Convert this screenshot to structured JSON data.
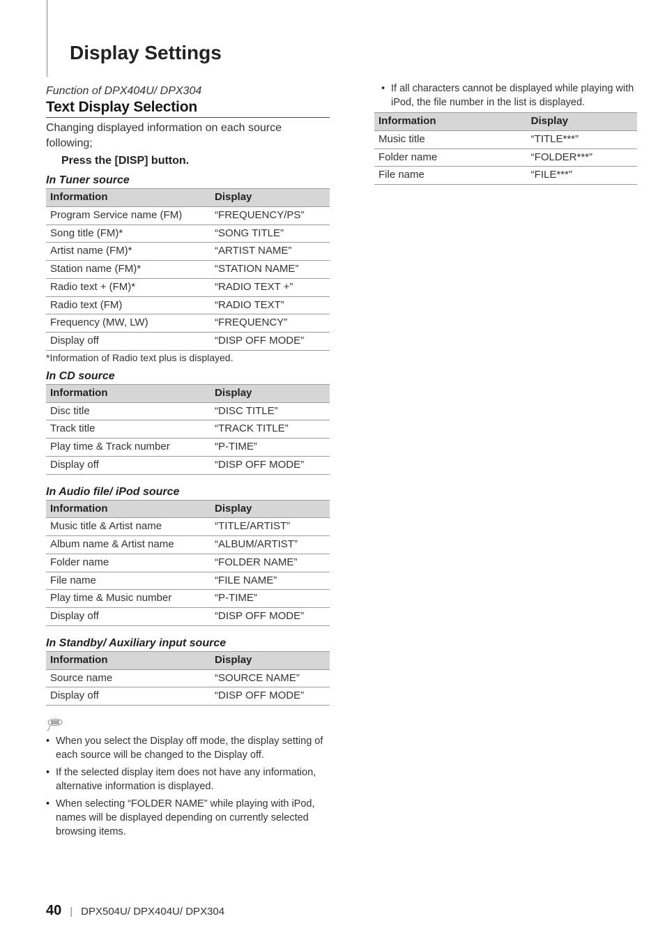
{
  "page": {
    "title": "Display Settings",
    "number": "40",
    "models": "DPX504U/ DPX404U/ DPX304"
  },
  "left": {
    "function_of": "Function of DPX404U/ DPX304",
    "section_heading": "Text Display Selection",
    "intro": "Changing displayed information on each source following;",
    "press": "Press the [DISP] button.",
    "tuner": {
      "heading": "In Tuner source",
      "cols": {
        "c1": "Information",
        "c2": "Display"
      },
      "rows": [
        {
          "c1": "Program Service name (FM)",
          "c2": "“FREQUENCY/PS”"
        },
        {
          "c1": "Song title (FM)*",
          "c2": "“SONG TITLE”"
        },
        {
          "c1": "Artist name (FM)*",
          "c2": "“ARTIST NAME”"
        },
        {
          "c1": "Station name (FM)*",
          "c2": "“STATION NAME”"
        },
        {
          "c1": "Radio text + (FM)*",
          "c2": "“RADIO TEXT +”"
        },
        {
          "c1": "Radio text (FM)",
          "c2": "“RADIO TEXT”"
        },
        {
          "c1": "Frequency (MW, LW)",
          "c2": "“FREQUENCY”"
        },
        {
          "c1": "Display off",
          "c2": "“DISP OFF MODE”"
        }
      ],
      "footnote": "*Information of Radio text plus is displayed."
    },
    "cd": {
      "heading": "In CD source",
      "cols": {
        "c1": "Information",
        "c2": "Display"
      },
      "rows": [
        {
          "c1": "Disc title",
          "c2": "“DISC TITLE”"
        },
        {
          "c1": "Track title",
          "c2": "“TRACK TITLE”"
        },
        {
          "c1": "Play time & Track number",
          "c2": "“P-TIME”"
        },
        {
          "c1": "Display off",
          "c2": "“DISP OFF MODE”"
        }
      ]
    },
    "audio": {
      "heading": "In Audio file/ iPod source",
      "cols": {
        "c1": "Information",
        "c2": "Display"
      },
      "rows": [
        {
          "c1": "Music title & Artist name",
          "c2": "“TITLE/ARTIST”"
        },
        {
          "c1": "Album name & Artist name",
          "c2": "“ALBUM/ARTIST”"
        },
        {
          "c1": "Folder name",
          "c2": "“FOLDER NAME”"
        },
        {
          "c1": "File name",
          "c2": "“FILE NAME”"
        },
        {
          "c1": "Play time & Music number",
          "c2": "“P-TIME”"
        },
        {
          "c1": "Display off",
          "c2": "“DISP OFF MODE”"
        }
      ]
    },
    "standby": {
      "heading": "In Standby/ Auxiliary input source",
      "cols": {
        "c1": "Information",
        "c2": "Display"
      },
      "rows": [
        {
          "c1": "Source name",
          "c2": "“SOURCE NAME”"
        },
        {
          "c1": "Display off",
          "c2": "“DISP OFF MODE”"
        }
      ]
    },
    "notes": [
      "When you select the Display off mode, the display setting of each source will be changed to the Display off.",
      "If the selected display item does not have any information, alternative information is displayed.",
      "When selecting “FOLDER NAME” while playing with iPod, names will be displayed depending on currently selected browsing items."
    ]
  },
  "right": {
    "bullet": "If all characters cannot be displayed while playing with iPod, the file number in the list is displayed.",
    "table": {
      "cols": {
        "c1": "Information",
        "c2": "Display"
      },
      "rows": [
        {
          "c1": "Music title",
          "c2": "“TITLE***”"
        },
        {
          "c1": "Folder name",
          "c2": "“FOLDER***”"
        },
        {
          "c1": "File name",
          "c2": "“FILE***”"
        }
      ]
    }
  }
}
